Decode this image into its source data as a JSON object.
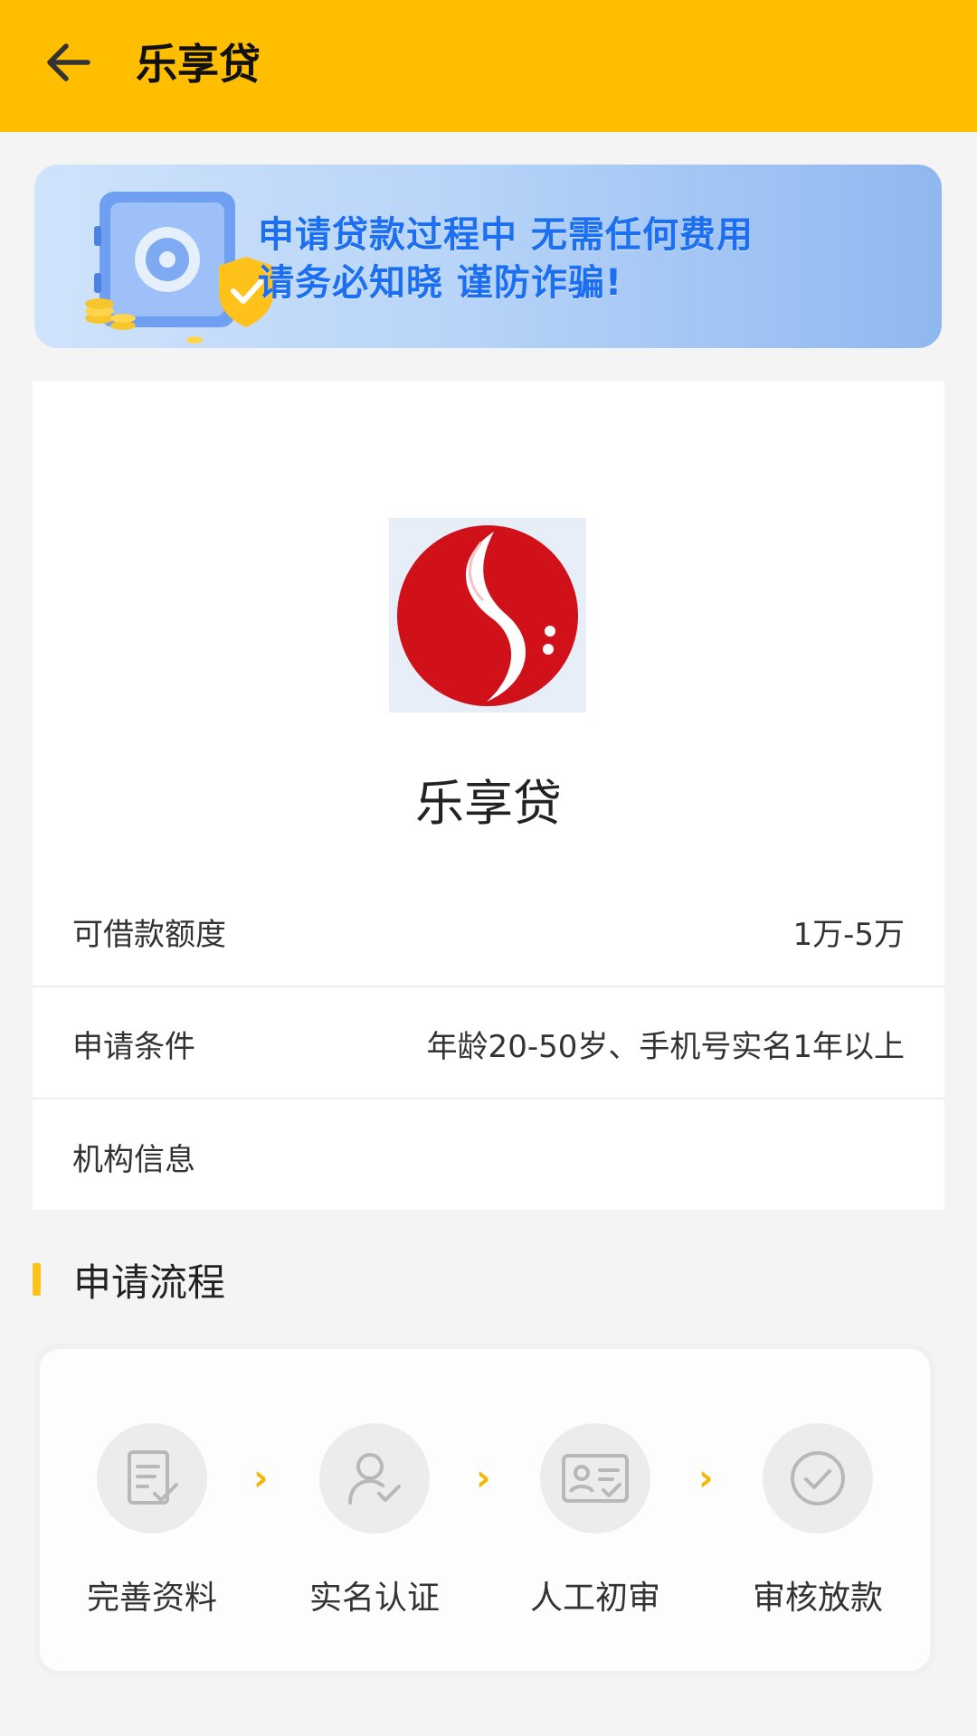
{
  "header": {
    "back_icon": "arrow-left-icon",
    "title": "乐享贷"
  },
  "banner": {
    "line1": "申请贷款过程中 无需任何费用",
    "line2": "请务必知晓 谨防诈骗!",
    "art_icon": "safe-shield-icon"
  },
  "product": {
    "logo_icon": "red-s-logo",
    "name": "乐享贷",
    "rows": [
      {
        "label": "可借款额度",
        "value": "1万-5万"
      },
      {
        "label": "申请条件",
        "value": "年龄20-50岁、手机号实名1年以上"
      },
      {
        "label": "机构信息",
        "value": ""
      }
    ]
  },
  "process": {
    "title": "申请流程",
    "steps": [
      {
        "label": "完善资料",
        "icon": "form-edit-icon"
      },
      {
        "label": "实名认证",
        "icon": "user-check-icon"
      },
      {
        "label": "人工初审",
        "icon": "id-card-icon"
      },
      {
        "label": "审核放款",
        "icon": "check-circle-icon"
      }
    ],
    "arrow": "›"
  },
  "colors": {
    "accent": "#ffbe00",
    "banner_text": "#1b6ff0",
    "logo_red": "#d0111a"
  }
}
